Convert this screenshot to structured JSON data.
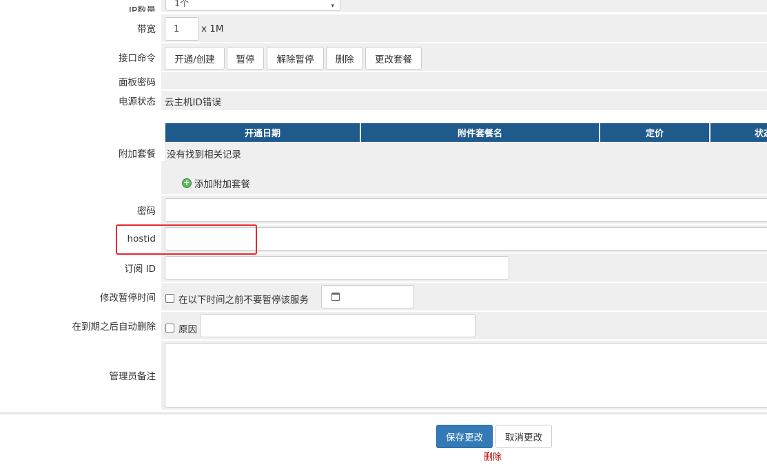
{
  "ip_count": {
    "label": "IP数量",
    "value": "1个"
  },
  "bandwidth": {
    "label": "带宽",
    "value": "1",
    "unit": "x 1M"
  },
  "interface_commands": {
    "label": "接口命令",
    "buttons": [
      "开通/创建",
      "暂停",
      "解除暂停",
      "删除",
      "更改套餐"
    ]
  },
  "panel_password": {
    "label": "面板密码",
    "value": ""
  },
  "power_status": {
    "label": "电源状态",
    "value": "云主机ID错误"
  },
  "addons": {
    "label": "附加套餐",
    "columns": [
      "开通日期",
      "附件套餐名",
      "定价",
      "状态"
    ],
    "empty_text": "没有找到相关记录",
    "add_link": "添加附加套餐"
  },
  "password": {
    "label": "密码",
    "value": ""
  },
  "hostid": {
    "label": "hostid",
    "value": ""
  },
  "subscription_id": {
    "label": "订阅 ID",
    "value": ""
  },
  "suspend_time": {
    "label": "修改暂停时间",
    "checkbox_label": "在以下时间之前不要暂停该服务"
  },
  "auto_delete": {
    "label": "在到期之后自动删除",
    "checkbox_label": "原因",
    "reason": ""
  },
  "admin_notes": {
    "label": "管理员备注",
    "value": ""
  },
  "footer": {
    "save_label": "保存更改",
    "cancel_label": "取消更改",
    "delete_label": "删除"
  },
  "colors": {
    "header_blue": "#1f5a8c",
    "highlight_red": "#e8272b",
    "delete_red": "#c00000",
    "primary": "#337ab7"
  }
}
